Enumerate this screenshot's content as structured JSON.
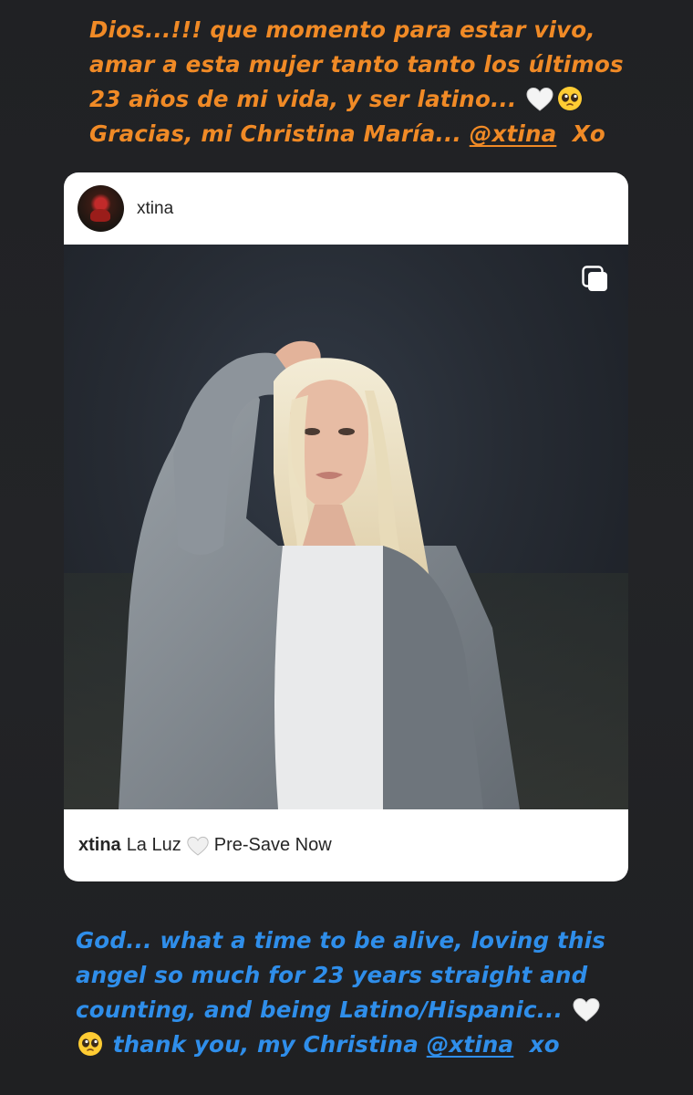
{
  "caption_top": {
    "line1": "Dios...!!! que momento para estar vivo,",
    "line2": "amar a esta mujer tanto tanto los últimos",
    "line3": "23 años de mi vida, y ser latino...",
    "line4_text": "Gracias, mi Christina María...",
    "mention": "@xtina",
    "line4_end": "Xo",
    "color": "#F08A26"
  },
  "post": {
    "author": "xtina",
    "footer_user": "xtina",
    "footer_text1": "La Luz",
    "footer_text2": "Pre-Save Now"
  },
  "caption_bottom": {
    "line1": "God... what a time to be alive, loving this",
    "line2": "angel so much for 23 years straight and",
    "line3": "counting, and being Latino/Hispanic...",
    "line4_text": "thank you, my Christina",
    "mention": "@xtina",
    "line4_end": "xo",
    "color": "#2F8EEA"
  },
  "icons": [
    "white-heart-icon",
    "pleading-face-icon",
    "multiple-photos-icon"
  ]
}
